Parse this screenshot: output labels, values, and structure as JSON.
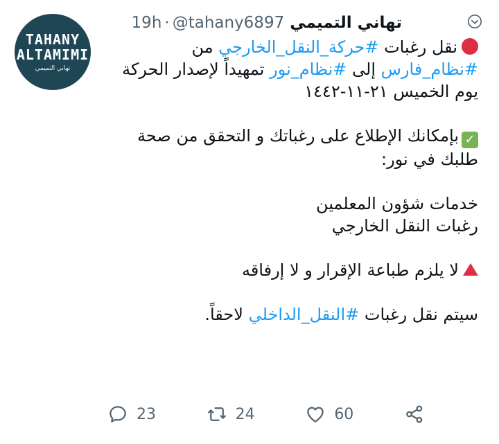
{
  "tweet": {
    "avatar": {
      "line1": "TAHANY",
      "line2": "ALTAMIMI",
      "line3": "تهاني التميمي"
    },
    "author_name": "تهاني التميمي",
    "handle": "@tahany6897",
    "separator": "·",
    "time": "19h",
    "body": {
      "p1_text1": "نقل رغبات ",
      "p1_tag1": "#حركة_النقل_الخارجي",
      "p1_text2": " من ",
      "p1_tag2": "#نظام_فارس",
      "p1_text3": " إلى ",
      "p1_tag3": "#نظام_نور",
      "p1_text4": " تمهيداً لإصدار الحركة يوم الخميس ٢١-١١-١٤٤٢",
      "p2_text": "بإمكانك الإطلاع على رغباتك و التحقق من صحة طلبك في نور:",
      "p3_line1": "خدمات شؤون المعلمين",
      "p3_line2": "رغبات النقل الخارجي",
      "p4_text": "لا يلزم طباعة الإقرار و لا إرفاقه",
      "p5_text1": "سيتم نقل رغبات ",
      "p5_tag": "#النقل_الداخلي",
      "p5_text2": " لاحقاً."
    },
    "icons": {
      "red_circle": "red-circle-emoji",
      "check": "check-mark-emoji",
      "triangle": "red-triangle-emoji",
      "more": "chevron-down-icon"
    },
    "colors": {
      "hashtag": "#1d9bf0",
      "muted": "#536471",
      "avatar_bg": "#1f4654"
    },
    "actions": {
      "replies": "23",
      "retweets": "24",
      "likes": "60"
    }
  }
}
